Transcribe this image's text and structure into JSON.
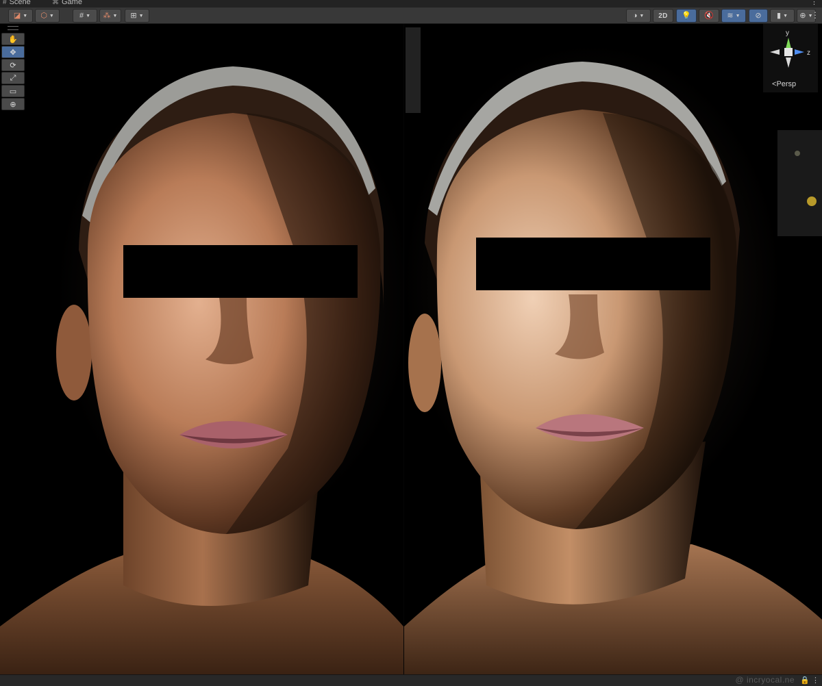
{
  "tabs": [
    {
      "label": "Scene",
      "icon": "hash-icon"
    },
    {
      "label": "Game",
      "icon": "gamepad-icon"
    }
  ],
  "toolbar": {
    "two_d_label": "2D",
    "colors": {
      "bg": "#383838",
      "button": "#4b4b4b",
      "active": "#4a6c9c"
    }
  },
  "scene_tools": [
    {
      "name": "hand-tool",
      "glyph": "✋",
      "active": false
    },
    {
      "name": "move-tool",
      "glyph": "✥",
      "active": true
    },
    {
      "name": "rotate-tool",
      "glyph": "⟳",
      "active": false
    },
    {
      "name": "scale-tool",
      "glyph": "⤢",
      "active": false
    },
    {
      "name": "rect-tool",
      "glyph": "▭",
      "active": false
    },
    {
      "name": "transform-tool",
      "glyph": "⊕",
      "active": false
    }
  ],
  "gizmo": {
    "y_label": "y",
    "z_label": "z",
    "projection_label": "Persp"
  },
  "status": {
    "watermark": "@ incryocal.ne"
  }
}
